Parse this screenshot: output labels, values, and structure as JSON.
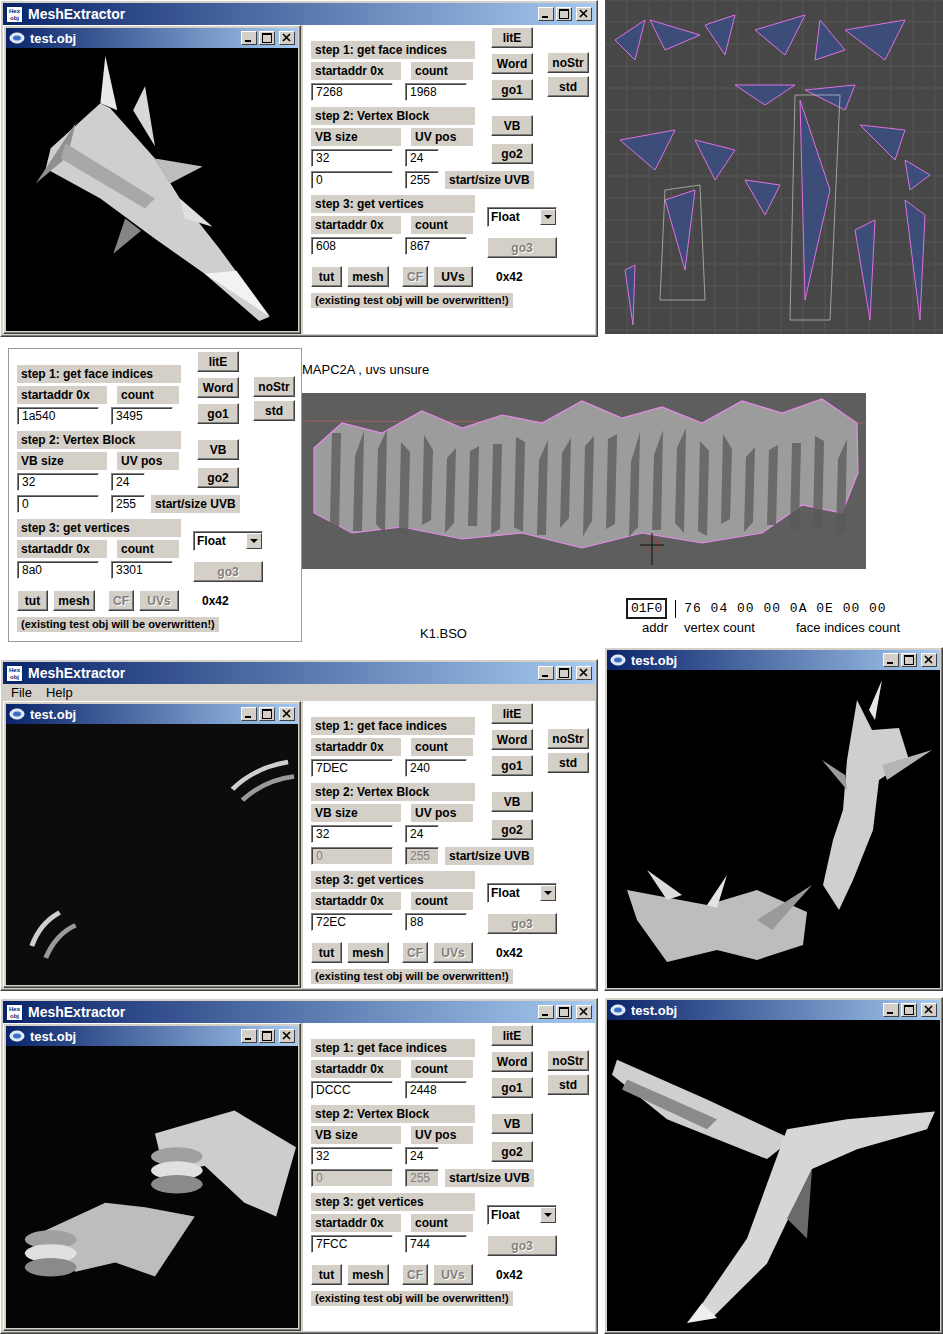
{
  "extractors": [
    {
      "title": "MeshExtractor",
      "icon": "Hex obj",
      "menu": [],
      "viewer": {
        "title": "test.obj"
      },
      "panel": {
        "step1": {
          "label": "step 1: get face indices",
          "col1": "startaddr 0x",
          "col2": "count",
          "start": "7268",
          "count": "1968"
        },
        "buttons1": [
          {
            "label": "litE",
            "disabled": false
          },
          {
            "label": "Word",
            "disabled": false
          },
          {
            "label": "go1",
            "disabled": false
          }
        ],
        "side_buttons": [
          {
            "label": "noStr",
            "disabled": false
          },
          {
            "label": "std",
            "disabled": false
          }
        ],
        "step2": {
          "label": "step 2: Vertex Block",
          "col1": "VB size",
          "col2": "UV pos",
          "vb_size": "32",
          "uv_pos": "24",
          "uvb_start": "0",
          "uvb_size": "255",
          "uvb_label": "start/size UVB",
          "uvb_disabled": false
        },
        "buttons2": [
          {
            "label": "VB",
            "disabled": false
          },
          {
            "label": "go2",
            "disabled": false
          }
        ],
        "step3": {
          "label": "step 3: get vertices",
          "col1": "startaddr 0x",
          "col2": "count",
          "start": "608",
          "count": "867",
          "type": "Float",
          "go3": {
            "label": "go3",
            "disabled": true
          }
        },
        "bottom_buttons": [
          {
            "label": "tut",
            "disabled": false
          },
          {
            "label": "mesh",
            "disabled": false
          },
          {
            "label": "CF",
            "disabled": true
          },
          {
            "label": "UVs",
            "disabled": false
          }
        ],
        "code": "0x42",
        "note": "(existing test obj will be overwritten!)"
      }
    },
    {
      "title": "MeshExtractor",
      "icon": "Hex obj",
      "menu": [
        "File",
        "Help"
      ],
      "viewer": {
        "title": "test.obj"
      },
      "panel": {
        "step1": {
          "label": "step 1: get face indices",
          "col1": "startaddr 0x",
          "col2": "count",
          "start": "7DEC",
          "count": "240"
        },
        "buttons1": [
          {
            "label": "litE",
            "disabled": false
          },
          {
            "label": "Word",
            "disabled": false
          },
          {
            "label": "go1",
            "disabled": false
          }
        ],
        "side_buttons": [
          {
            "label": "noStr",
            "disabled": false
          },
          {
            "label": "std",
            "disabled": false
          }
        ],
        "step2": {
          "label": "step 2: Vertex Block",
          "col1": "VB size",
          "col2": "UV pos",
          "vb_size": "32",
          "uv_pos": "24",
          "uvb_start": "0",
          "uvb_size": "255",
          "uvb_label": "start/size UVB",
          "uvb_disabled": true
        },
        "buttons2": [
          {
            "label": "VB",
            "disabled": false
          },
          {
            "label": "go2",
            "disabled": false
          }
        ],
        "step3": {
          "label": "step 3: get vertices",
          "col1": "startaddr 0x",
          "col2": "count",
          "start": "72EC",
          "count": "88",
          "type": "Float",
          "go3": {
            "label": "go3",
            "disabled": true
          }
        },
        "bottom_buttons": [
          {
            "label": "tut",
            "disabled": false
          },
          {
            "label": "mesh",
            "disabled": false
          },
          {
            "label": "CF",
            "disabled": true
          },
          {
            "label": "UVs",
            "disabled": true
          }
        ],
        "code": "0x42",
        "note": "(existing test obj will be overwritten!)"
      }
    },
    {
      "title": "MeshExtractor",
      "icon": "Hex obj",
      "menu": [],
      "viewer": {
        "title": "test.obj"
      },
      "panel": {
        "step1": {
          "label": "step 1: get face indices",
          "col1": "startaddr 0x",
          "col2": "count",
          "start": "DCCC",
          "count": "2448"
        },
        "buttons1": [
          {
            "label": "litE",
            "disabled": false
          },
          {
            "label": "Word",
            "disabled": false
          },
          {
            "label": "go1",
            "disabled": false
          }
        ],
        "side_buttons": [
          {
            "label": "noStr",
            "disabled": false
          },
          {
            "label": "std",
            "disabled": false
          }
        ],
        "step2": {
          "label": "step 2: Vertex Block",
          "col1": "VB size",
          "col2": "UV pos",
          "vb_size": "32",
          "uv_pos": "24",
          "uvb_start": "0",
          "uvb_size": "255",
          "uvb_label": "start/size UVB",
          "uvb_disabled": true
        },
        "buttons2": [
          {
            "label": "VB",
            "disabled": false
          },
          {
            "label": "go2",
            "disabled": false
          }
        ],
        "step3": {
          "label": "step 3: get vertices",
          "col1": "startaddr 0x",
          "col2": "count",
          "start": "7FCC",
          "count": "744",
          "type": "Float",
          "go3": {
            "label": "go3",
            "disabled": true
          }
        },
        "bottom_buttons": [
          {
            "label": "tut",
            "disabled": false
          },
          {
            "label": "mesh",
            "disabled": false
          },
          {
            "label": "CF",
            "disabled": true
          },
          {
            "label": "UVs",
            "disabled": true
          }
        ],
        "code": "0x42",
        "note": "(existing test obj will be overwritten!)"
      }
    }
  ],
  "loose_panel": {
    "step1": {
      "label": "step 1: get face indices",
      "col1": "startaddr 0x",
      "col2": "count",
      "start": "1a540",
      "count": "3495"
    },
    "buttons1": [
      {
        "label": "litE",
        "disabled": false
      },
      {
        "label": "Word",
        "disabled": false
      },
      {
        "label": "go1",
        "disabled": false
      }
    ],
    "side_buttons": [
      {
        "label": "noStr",
        "disabled": false
      },
      {
        "label": "std",
        "disabled": false
      }
    ],
    "step2": {
      "label": "step 2: Vertex Block",
      "col1": "VB size",
      "col2": "UV pos",
      "vb_size": "32",
      "uv_pos": "24",
      "uvb_start": "0",
      "uvb_size": "255",
      "uvb_label": "start/size UVB",
      "uvb_disabled": false
    },
    "buttons2": [
      {
        "label": "VB",
        "disabled": false
      },
      {
        "label": "go2",
        "disabled": false
      }
    ],
    "step3": {
      "label": "step 3: get vertices",
      "col1": "startaddr 0x",
      "col2": "count",
      "start": "8a0",
      "count": "3301",
      "type": "Float",
      "go3": {
        "label": "go3",
        "disabled": true
      }
    },
    "bottom_buttons": [
      {
        "label": "tut",
        "disabled": false
      },
      {
        "label": "mesh",
        "disabled": false
      },
      {
        "label": "CF",
        "disabled": true
      },
      {
        "label": "UVs",
        "disabled": true
      }
    ],
    "code": "0x42",
    "note": "(existing test obj will be overwritten!)"
  },
  "viewers": [
    {
      "title": "test.obj"
    },
    {
      "title": "test.obj"
    }
  ],
  "preview": {
    "caption": "MAPC2A , uvs unsure"
  },
  "hex": {
    "addr": "01F0",
    "bytes": "76 04 00 00 0A 0E 00 00",
    "labels": [
      "addr",
      "vertex count",
      "face indices count"
    ],
    "file": "K1.BSO"
  }
}
